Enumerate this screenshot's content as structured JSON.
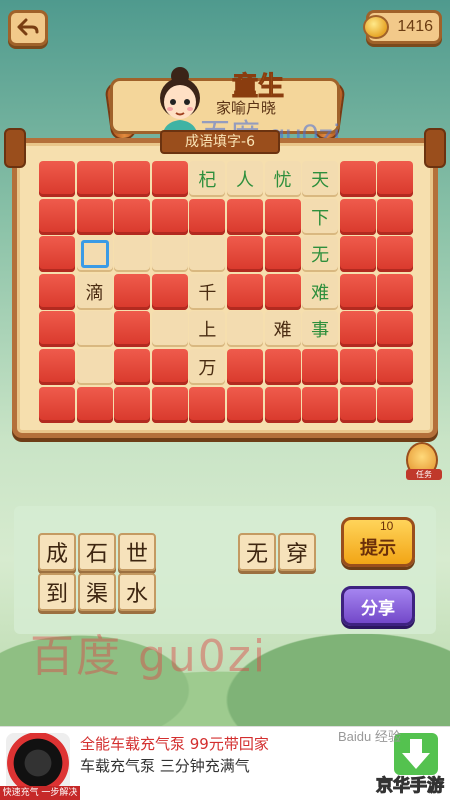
{
  "coins": "1416",
  "rank": {
    "title": "童生",
    "subtitle": "家喻户晓"
  },
  "level_tag": "成语填字-6",
  "board": {
    "rows": [
      [
        {
          "t": "r"
        },
        {
          "t": "r"
        },
        {
          "t": "r"
        },
        {
          "t": "r"
        },
        {
          "t": "s",
          "c": "杞"
        },
        {
          "t": "s",
          "c": "人"
        },
        {
          "t": "s",
          "c": "忧"
        },
        {
          "t": "s",
          "c": "天"
        },
        {
          "t": "r"
        },
        {
          "t": "r"
        }
      ],
      [
        {
          "t": "r"
        },
        {
          "t": "r"
        },
        {
          "t": "r"
        },
        {
          "t": "r"
        },
        {
          "t": "r"
        },
        {
          "t": "r"
        },
        {
          "t": "r"
        },
        {
          "t": "s",
          "c": "下"
        },
        {
          "t": "r"
        },
        {
          "t": "r"
        }
      ],
      [
        {
          "t": "r"
        },
        {
          "t": "sel"
        },
        {
          "t": "b"
        },
        {
          "t": "b"
        },
        {
          "t": "b"
        },
        {
          "t": "r"
        },
        {
          "t": "r"
        },
        {
          "t": "s",
          "c": "无"
        },
        {
          "t": "r"
        },
        {
          "t": "r"
        }
      ],
      [
        {
          "t": "r"
        },
        {
          "t": "g",
          "c": "滴"
        },
        {
          "t": "r"
        },
        {
          "t": "r"
        },
        {
          "t": "g",
          "c": "千"
        },
        {
          "t": "r"
        },
        {
          "t": "r"
        },
        {
          "t": "s",
          "c": "难"
        },
        {
          "t": "r"
        },
        {
          "t": "r"
        }
      ],
      [
        {
          "t": "r"
        },
        {
          "t": "b"
        },
        {
          "t": "r"
        },
        {
          "t": "b"
        },
        {
          "t": "g",
          "c": "上"
        },
        {
          "t": "b"
        },
        {
          "t": "g",
          "c": "难"
        },
        {
          "t": "s",
          "c": "事"
        },
        {
          "t": "r"
        },
        {
          "t": "r"
        }
      ],
      [
        {
          "t": "r"
        },
        {
          "t": "b"
        },
        {
          "t": "r"
        },
        {
          "t": "r"
        },
        {
          "t": "g",
          "c": "万"
        },
        {
          "t": "r"
        },
        {
          "t": "r"
        },
        {
          "t": "r"
        },
        {
          "t": "r"
        },
        {
          "t": "r"
        }
      ],
      [
        {
          "t": "r"
        },
        {
          "t": "r"
        },
        {
          "t": "r"
        },
        {
          "t": "r"
        },
        {
          "t": "r"
        },
        {
          "t": "r"
        },
        {
          "t": "r"
        },
        {
          "t": "r"
        },
        {
          "t": "r"
        },
        {
          "t": "r"
        }
      ]
    ]
  },
  "choices_a": [
    "成",
    "石",
    "世",
    "到",
    "渠",
    "水"
  ],
  "choices_b": [
    "无",
    "穿"
  ],
  "hint": {
    "label": "提示",
    "cost": "10"
  },
  "share_label": "分享",
  "side_badge_label": "任务",
  "watermarks": {
    "top": "百度 gu0zi",
    "bottom": "百度 gu0zi"
  },
  "ad": {
    "line1": "全能车载充气泵 99元带回家",
    "line2": "车载充气泵 三分钟充满气",
    "caption": "快速充气 一步解决",
    "brand": "Baidu 经验",
    "corner": "京华手游"
  }
}
